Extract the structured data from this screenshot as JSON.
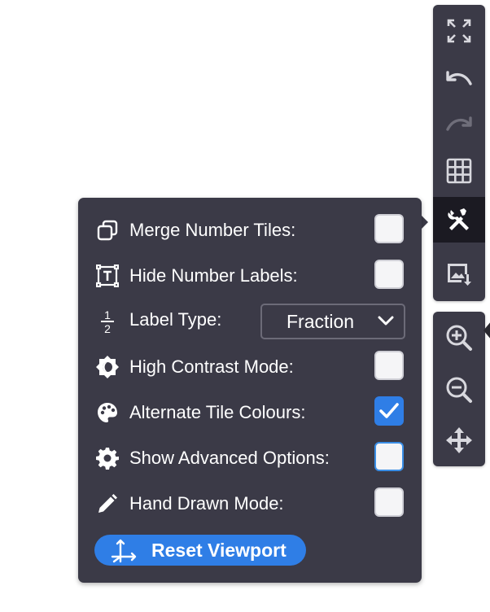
{
  "toolbar": {
    "buttons": [
      {
        "name": "fullscreen",
        "icon": "expand-icon"
      },
      {
        "name": "undo",
        "icon": "undo-icon"
      },
      {
        "name": "redo",
        "icon": "redo-icon",
        "disabled": true
      },
      {
        "name": "grid",
        "icon": "grid-icon"
      },
      {
        "name": "settings",
        "icon": "tools-icon",
        "active": true
      },
      {
        "name": "export-image",
        "icon": "image-download-icon"
      }
    ],
    "zoom_buttons": [
      {
        "name": "zoom-in",
        "icon": "zoom-in-icon"
      },
      {
        "name": "zoom-out",
        "icon": "zoom-out-icon"
      },
      {
        "name": "pan",
        "icon": "move-icon"
      }
    ]
  },
  "settings": {
    "merge_tiles": {
      "label": "Merge Number Tiles:",
      "checked": false
    },
    "hide_labels": {
      "label": "Hide Number Labels:",
      "checked": false
    },
    "label_type": {
      "label": "Label Type:",
      "value": "Fraction",
      "icon_text": {
        "numerator": "1",
        "denominator": "2"
      }
    },
    "high_contrast": {
      "label": "High Contrast Mode:",
      "checked": false
    },
    "alternate_colours": {
      "label": "Alternate Tile Colours:",
      "checked": true
    },
    "advanced_options": {
      "label": "Show Advanced Options:",
      "checked": false
    },
    "hand_drawn": {
      "label": "Hand Drawn Mode:",
      "checked": false
    }
  },
  "reset_button": {
    "label": "Reset Viewport"
  },
  "colors": {
    "panel": "#3b3a47",
    "accent": "#2f7ee6",
    "active_tool": "#1b1a22"
  }
}
